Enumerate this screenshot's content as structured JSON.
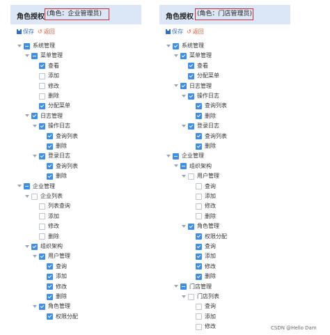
{
  "left_panel": {
    "title": "角色授权",
    "role": "(角色：企业管理员)",
    "save_label": "保存",
    "back_label": "返回",
    "nodes": [
      {
        "depth": 0,
        "label": "系统管理",
        "state": "half",
        "expanded": true
      },
      {
        "depth": 1,
        "label": "菜单管理",
        "state": "half",
        "expanded": true
      },
      {
        "depth": 2,
        "label": "查看",
        "state": "checked"
      },
      {
        "depth": 2,
        "label": "添加",
        "state": "unchecked"
      },
      {
        "depth": 2,
        "label": "修改",
        "state": "unchecked"
      },
      {
        "depth": 2,
        "label": "删除",
        "state": "unchecked"
      },
      {
        "depth": 2,
        "label": "分配菜单",
        "state": "checked"
      },
      {
        "depth": 1,
        "label": "日志管理",
        "state": "checked",
        "expanded": true
      },
      {
        "depth": 2,
        "label": "操作日志",
        "state": "checked",
        "expanded": true
      },
      {
        "depth": 3,
        "label": "查询列表",
        "state": "checked"
      },
      {
        "depth": 3,
        "label": "删除",
        "state": "checked"
      },
      {
        "depth": 2,
        "label": "登录日志",
        "state": "checked",
        "expanded": true
      },
      {
        "depth": 3,
        "label": "查询列表",
        "state": "checked"
      },
      {
        "depth": 3,
        "label": "删除",
        "state": "checked"
      },
      {
        "depth": 0,
        "label": "企业管理",
        "state": "half",
        "expanded": true
      },
      {
        "depth": 1,
        "label": "企业列表",
        "state": "unchecked",
        "expanded": true
      },
      {
        "depth": 2,
        "label": "列表查询",
        "state": "unchecked"
      },
      {
        "depth": 2,
        "label": "添加",
        "state": "unchecked"
      },
      {
        "depth": 2,
        "label": "修改",
        "state": "unchecked"
      },
      {
        "depth": 2,
        "label": "删除",
        "state": "unchecked"
      },
      {
        "depth": 1,
        "label": "组织架构",
        "state": "checked",
        "expanded": true
      },
      {
        "depth": 2,
        "label": "用户管理",
        "state": "checked",
        "expanded": true
      },
      {
        "depth": 3,
        "label": "查询",
        "state": "checked"
      },
      {
        "depth": 3,
        "label": "添加",
        "state": "checked"
      },
      {
        "depth": 3,
        "label": "修改",
        "state": "checked"
      },
      {
        "depth": 3,
        "label": "删除",
        "state": "checked"
      },
      {
        "depth": 2,
        "label": "角色管理",
        "state": "checked",
        "expanded": true
      },
      {
        "depth": 3,
        "label": "权限分配",
        "state": "checked"
      }
    ]
  },
  "right_panel": {
    "title": "角色授权",
    "role": "(角色：门店管理员)",
    "save_label": "保存",
    "back_label": "返回",
    "nodes": [
      {
        "depth": 0,
        "label": "系统管理",
        "state": "checked",
        "expanded": true
      },
      {
        "depth": 1,
        "label": "菜单管理",
        "state": "checked",
        "expanded": true
      },
      {
        "depth": 2,
        "label": "查看",
        "state": "checked"
      },
      {
        "depth": 2,
        "label": "分配菜单",
        "state": "checked"
      },
      {
        "depth": 1,
        "label": "日志管理",
        "state": "checked",
        "expanded": true
      },
      {
        "depth": 2,
        "label": "操作日志",
        "state": "checked",
        "expanded": true
      },
      {
        "depth": 3,
        "label": "查询列表",
        "state": "checked"
      },
      {
        "depth": 3,
        "label": "删除",
        "state": "checked"
      },
      {
        "depth": 2,
        "label": "登录日志",
        "state": "checked",
        "expanded": true
      },
      {
        "depth": 3,
        "label": "查询列表",
        "state": "checked"
      },
      {
        "depth": 3,
        "label": "删除",
        "state": "checked"
      },
      {
        "depth": 0,
        "label": "企业管理",
        "state": "half",
        "expanded": true
      },
      {
        "depth": 1,
        "label": "组织架构",
        "state": "half",
        "expanded": true
      },
      {
        "depth": 2,
        "label": "用户管理",
        "state": "unchecked",
        "expanded": true
      },
      {
        "depth": 3,
        "label": "查询",
        "state": "unchecked"
      },
      {
        "depth": 3,
        "label": "添加",
        "state": "unchecked"
      },
      {
        "depth": 3,
        "label": "修改",
        "state": "unchecked"
      },
      {
        "depth": 3,
        "label": "删除",
        "state": "unchecked"
      },
      {
        "depth": 2,
        "label": "角色管理",
        "state": "checked",
        "expanded": true
      },
      {
        "depth": 3,
        "label": "权限分配",
        "state": "checked"
      },
      {
        "depth": 3,
        "label": "查询",
        "state": "checked"
      },
      {
        "depth": 3,
        "label": "添加",
        "state": "checked"
      },
      {
        "depth": 3,
        "label": "修改",
        "state": "checked"
      },
      {
        "depth": 3,
        "label": "删除",
        "state": "checked"
      },
      {
        "depth": 1,
        "label": "门店管理",
        "state": "half",
        "expanded": true
      },
      {
        "depth": 2,
        "label": "门店列表",
        "state": "unchecked",
        "expanded": true
      },
      {
        "depth": 3,
        "label": "查询",
        "state": "unchecked"
      },
      {
        "depth": 3,
        "label": "添加",
        "state": "unchecked"
      },
      {
        "depth": 3,
        "label": "修改",
        "state": "unchecked"
      }
    ]
  },
  "watermark": "CSDN @Hello Dam",
  "colors": {
    "accent": "#3d8ee8",
    "highlight_border": "#d9282b",
    "header_bg": "#dbe7f6",
    "back": "#e8542c"
  }
}
